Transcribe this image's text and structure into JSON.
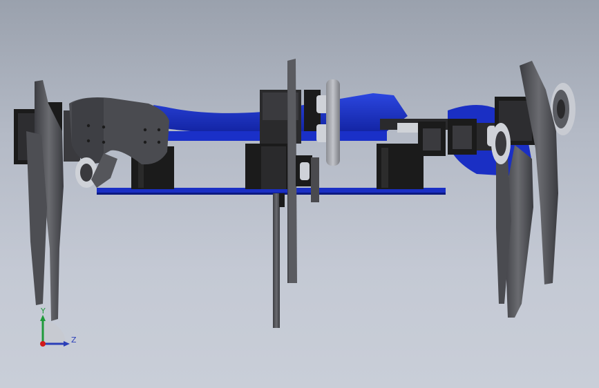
{
  "viewport": {
    "background_top": "#9aa1ad",
    "background_bottom": "#c9ced8",
    "model_colors": {
      "frame": "#1a2fc4",
      "frame_dark": "#0d1a80",
      "servo": "#1b1b1b",
      "bracket": "#4a4a4e",
      "leg": "#55565b",
      "bearing": "#d9dbe0"
    }
  },
  "triad": {
    "y_label": "Y",
    "z_label": "Z",
    "y_color": "#1f9a3a",
    "z_color": "#2b3fb8",
    "origin_color": "#d11a1a"
  }
}
